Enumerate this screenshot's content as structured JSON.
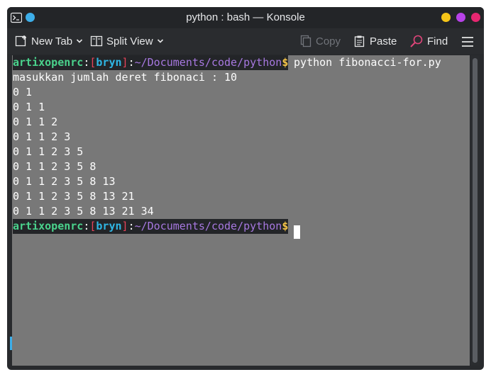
{
  "window": {
    "title": "python : bash — Konsole",
    "colors": {
      "minimize": "#f5c518",
      "maximize": "#b742e8",
      "close": "#e62771",
      "indicator": "#3daee9",
      "terminal_bg": "#787878"
    }
  },
  "toolbar": {
    "new_tab": "New Tab",
    "split_view": "Split View",
    "copy": "Copy",
    "paste": "Paste",
    "find": "Find"
  },
  "terminal": {
    "prompt": {
      "user": "artixopenrc",
      "colon1": ":",
      "lbr": "[",
      "host": "bryn",
      "rbr": "]",
      "colon2": ":",
      "path": "~/Documents/code/python",
      "dollar": "$"
    },
    "command": " python fibonacci-for.py",
    "output": [
      "masukkan jumlah deret fibonaci : 10",
      "0 1",
      "0 1 1",
      "0 1 1 2",
      "0 1 1 2 3",
      "0 1 1 2 3 5",
      "0 1 1 2 3 5 8",
      "0 1 1 2 3 5 8 13",
      "0 1 1 2 3 5 8 13 21",
      "0 1 1 2 3 5 8 13 21 34"
    ]
  }
}
